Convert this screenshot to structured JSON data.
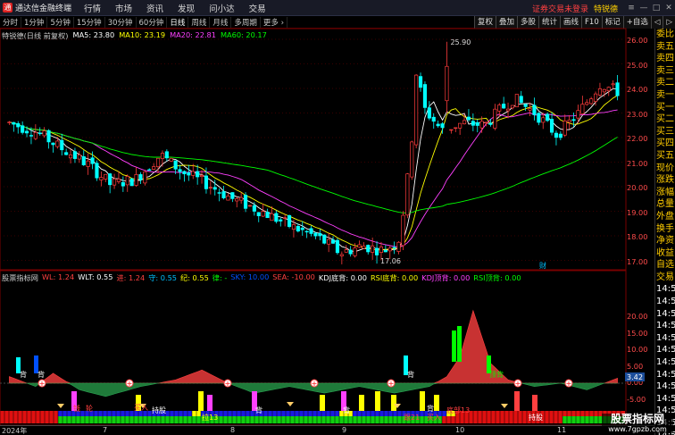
{
  "app": {
    "logo_text": "通达信金融终端",
    "menu": [
      "行情",
      "市场",
      "资讯",
      "发现",
      "问小达",
      "交易"
    ],
    "login_text": "证券交易未登录",
    "stock_badge": "特锐德",
    "right_icons": [
      "≡",
      "—",
      "□",
      "✕"
    ]
  },
  "periods": [
    "分时",
    "1分钟",
    "5分钟",
    "15分钟",
    "30分钟",
    "60分钟",
    "日线",
    "周线",
    "月线",
    "多周期",
    "更多 ›"
  ],
  "active_period": "日线",
  "tools": [
    "复权",
    "叠加",
    "多股",
    "统计",
    "画线",
    "F10",
    "标记",
    "+自选",
    "◁",
    "▷"
  ],
  "main_indicator": {
    "name": "特锐德(日线 前复权)",
    "items": [
      {
        "label": "MA5: 23.80",
        "color": "#ffffff"
      },
      {
        "label": "MA10: 23.19",
        "color": "#ffff00"
      },
      {
        "label": "MA20: 22.81",
        "color": "#ff40ff"
      },
      {
        "label": "MA60: 20.17",
        "color": "#00ff00"
      }
    ]
  },
  "sub_indicator": {
    "name": "股票指标网",
    "items": [
      {
        "label": "WL: 1.24",
        "color": "#ff4040"
      },
      {
        "label": "WLT: 0.55",
        "color": "#ffffff"
      },
      {
        "label": "进: 1.24",
        "color": "#ff4040"
      },
      {
        "label": "守: 0.55",
        "color": "#00c0ff"
      },
      {
        "label": "纪: 0.55",
        "color": "#ffff00"
      },
      {
        "label": "律: -",
        "color": "#00ff00"
      },
      {
        "label": "SKY: 10.00",
        "color": "#0050ff"
      },
      {
        "label": "SEA: -10.00",
        "color": "#ff4040"
      },
      {
        "label": "KDJ底背: 0.00",
        "color": "#ffffff"
      },
      {
        "label": "RSI底背: 0.00",
        "color": "#ffff00"
      },
      {
        "label": "KDJ顶背: 0.00",
        "color": "#ff40ff"
      },
      {
        "label": "RSI顶背: 0.00",
        "color": "#00ff00"
      }
    ]
  },
  "price_axis": [
    "26.00",
    "25.00",
    "24.00",
    "23.00",
    "22.00",
    "21.00",
    "20.00",
    "19.00",
    "18.00",
    "17.00"
  ],
  "sub_axis": [
    "20.00",
    "15.00",
    "10.00",
    "5.00",
    "0.00",
    "-5.00"
  ],
  "current_marker": "3.42",
  "price_labels": {
    "high": "25.90",
    "low": "17.06",
    "event": "财"
  },
  "sub_labels": [
    {
      "text": "背",
      "color": "#ffffff"
    },
    {
      "text": "背",
      "color": "#ffffff"
    },
    {
      "text": "背",
      "color": "#ffffff"
    },
    {
      "text": "顶背",
      "color": "#00ff00"
    },
    {
      "text": "钱",
      "color": "#ff4040"
    },
    {
      "text": "轮",
      "color": "#ff4040"
    },
    {
      "text": "拉13",
      "color": "#ffff00"
    },
    {
      "text": "背",
      "color": "#ffffff"
    },
    {
      "text": "背",
      "color": "#ffffff"
    },
    {
      "text": "跟21",
      "color": "#ff4040"
    },
    {
      "text": "背",
      "color": "#ffffff"
    },
    {
      "text": "底部13",
      "color": "#ff4040"
    },
    {
      "text": "持股",
      "color": "#ffffff"
    },
    {
      "text": "持股",
      "color": "#ffffff"
    },
    {
      "text": "买入",
      "color": "#ff4040"
    },
    {
      "text": "买入",
      "color": "#ff4040"
    }
  ],
  "dates": [
    "2024年",
    "7",
    "8",
    "9",
    "10",
    "11"
  ],
  "sidebar": [
    "委比",
    "卖五",
    "卖四",
    "卖三",
    "卖二",
    "卖一",
    "买一",
    "买二",
    "买三",
    "买四",
    "买五",
    "现价",
    "涨跌",
    "涨幅",
    "总量",
    "外盘",
    "换手",
    "净资",
    "收益",
    "自选",
    "交易",
    "14:50",
    "14:50",
    "14:50",
    "14:50",
    "14:50",
    "14:50",
    "14:50",
    "14:50",
    "14:50",
    "14:50",
    "14:50",
    "14:50",
    "14:50"
  ],
  "brand": {
    "title": "股票指标网",
    "url": "www.7gpzb.com"
  },
  "colors": {
    "up": "#ff3c3c",
    "down": "#00ffff",
    "ma5": "#ffffff",
    "ma10": "#ffff00",
    "ma20": "#ff40ff",
    "ma60": "#00ff00",
    "accent": "#ffcc00"
  }
}
